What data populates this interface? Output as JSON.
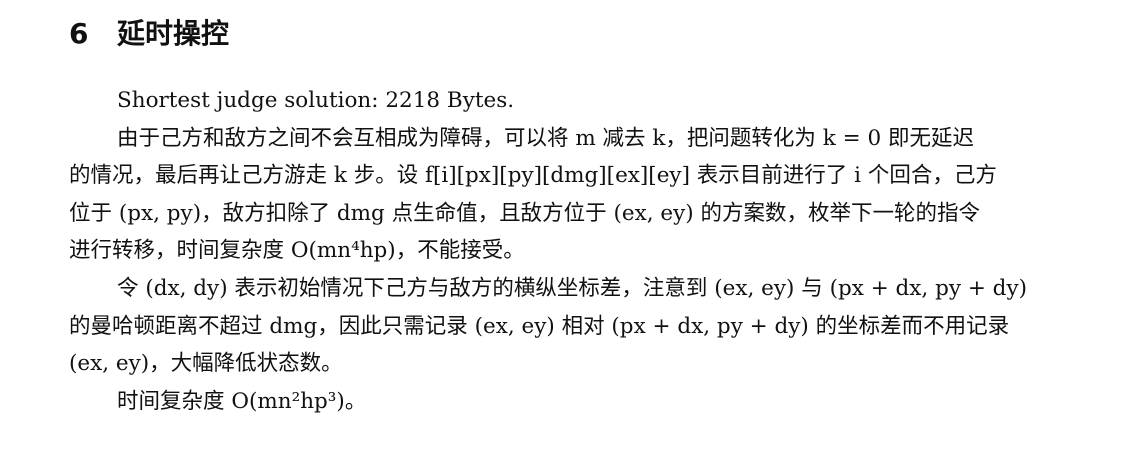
{
  "section": {
    "number": "6",
    "title": "延时操控"
  },
  "lines": [
    "Shortest judge solution: 2218 Bytes.",
    "由于己方和敌方之间不会互相成为障碍，可以将 m 减去 k，把问题转化为 k = 0 即无延迟",
    "的情况，最后再让己方游走 k 步。设 f[i][px][py][dmg][ex][ey] 表示目前进行了 i 个回合，己方",
    "位于 (px, py)，敌方扣除了 dmg 点生命值，且敌方位于 (ex, ey) 的方案数，枚举下一轮的指令",
    "进行转移，时间复杂度 O(mn⁴hp)，不能接受。",
    "令 (dx, dy) 表示初始情况下己方与敌方的横纵坐标差，注意到 (ex, ey) 与 (px + dx, py + dy)",
    "的曼哈顿距离不超过 dmg，因此只需记录 (ex, ey) 相对 (px + dx, py + dy) 的坐标差而不用记录",
    "(ex, ey)，大幅降低状态数。",
    "时间复杂度 O(mn²hp³)。"
  ]
}
